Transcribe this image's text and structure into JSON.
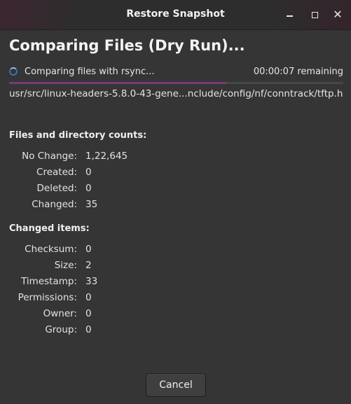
{
  "window": {
    "title": "Restore Snapshot",
    "controls": [
      "minimize-icon",
      "maximize-icon",
      "close-icon"
    ]
  },
  "heading": "Comparing Files (Dry Run)...",
  "status": {
    "text": "Comparing files with rsync...",
    "remaining": "00:00:07 remaining",
    "progress_percent": 65
  },
  "current_path": "usr/src/linux-headers-5.8.0-43-gene...nclude/config/nf/conntrack/tftp.h",
  "counts": {
    "title": "Files and directory counts:",
    "rows": [
      {
        "label": "No Change:",
        "value": "1,22,645"
      },
      {
        "label": "Created:",
        "value": "0"
      },
      {
        "label": "Deleted:",
        "value": "0"
      },
      {
        "label": "Changed:",
        "value": "35"
      }
    ]
  },
  "changed_items": {
    "title": "Changed items:",
    "rows": [
      {
        "label": "Checksum:",
        "value": "0"
      },
      {
        "label": "Size:",
        "value": "2"
      },
      {
        "label": "Timestamp:",
        "value": "33"
      },
      {
        "label": "Permissions:",
        "value": "0"
      },
      {
        "label": "Owner:",
        "value": "0"
      },
      {
        "label": "Group:",
        "value": "0"
      }
    ]
  },
  "buttons": {
    "cancel": "Cancel"
  },
  "colors": {
    "accent": "#7a3a7a",
    "background": "#353535",
    "titlebar": "#2d2d2d"
  }
}
